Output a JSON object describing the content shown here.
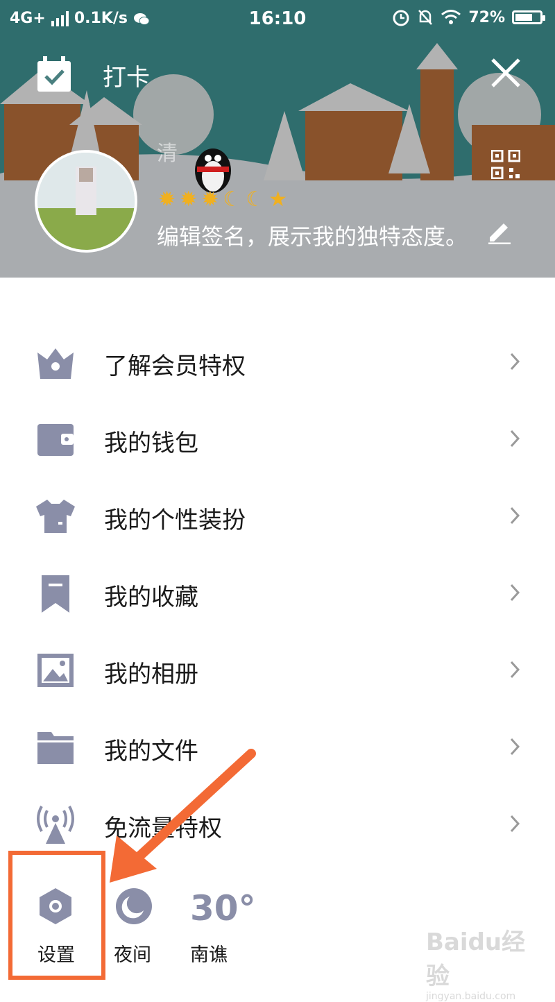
{
  "status_bar": {
    "network": "4G+",
    "speed": "0.1K/s",
    "time": "16:10",
    "battery": "72%",
    "battery_level": 0.72,
    "icons": [
      "signal-icon",
      "wechat-icon",
      "alarm-icon",
      "mute-bell-icon",
      "wifi-icon",
      "battery-icon"
    ]
  },
  "header": {
    "checkin_label": "打卡",
    "username": "清",
    "level_icons": [
      "sun-icon",
      "sun-icon",
      "sun-icon",
      "moon-icon",
      "moon-icon",
      "star-icon"
    ],
    "signature": "编辑签名，展示我的独特态度。"
  },
  "menu": {
    "items": [
      {
        "label": "了解会员特权",
        "icon": "crown-icon"
      },
      {
        "label": "我的钱包",
        "icon": "wallet-icon"
      },
      {
        "label": "我的个性装扮",
        "icon": "shirt-icon"
      },
      {
        "label": "我的收藏",
        "icon": "bookmark-icon"
      },
      {
        "label": "我的相册",
        "icon": "photo-icon"
      },
      {
        "label": "我的文件",
        "icon": "folder-icon"
      },
      {
        "label": "免流量特权",
        "icon": "signal-tower-icon"
      }
    ]
  },
  "bottom_bar": {
    "settings_label": "设置",
    "night_label": "夜间",
    "temperature": "30°",
    "city": "南谯"
  },
  "watermark": {
    "brand": "Baidu经验",
    "url": "jingyan.baidu.com"
  },
  "colors": {
    "icon_gray": "#8a8ea8",
    "annotation_orange": "#f36a35",
    "header_teal": "#3a8a8a"
  }
}
